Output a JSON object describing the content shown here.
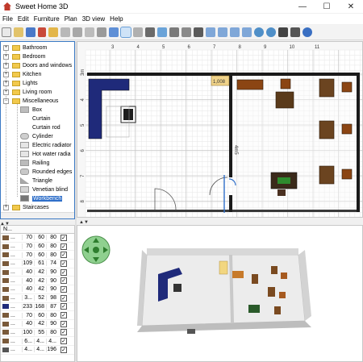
{
  "window": {
    "title": "Sweet Home 3D"
  },
  "menubar": {
    "items": [
      "File",
      "Edit",
      "Furniture",
      "Plan",
      "3D view",
      "Help"
    ]
  },
  "catalog": {
    "categories": [
      {
        "label": "Bathroom"
      },
      {
        "label": "Bedroom"
      },
      {
        "label": "Doors and windows"
      },
      {
        "label": "Kitchen"
      },
      {
        "label": "Lights"
      },
      {
        "label": "Living room"
      },
      {
        "label": "Miscellaneous"
      }
    ],
    "misc_items": [
      {
        "label": "Box"
      },
      {
        "label": "Curtain"
      },
      {
        "label": "Curtain rod"
      },
      {
        "label": "Cylinder"
      },
      {
        "label": "Electric radiator"
      },
      {
        "label": "Hot water radia"
      },
      {
        "label": "Railing"
      },
      {
        "label": "Rounded edges"
      },
      {
        "label": "Triangle"
      },
      {
        "label": "Venetian blind"
      },
      {
        "label": "Workbench"
      }
    ],
    "last_category": "Staircases",
    "selected": "Workbench"
  },
  "furniture_table": {
    "header": "N...",
    "rows": [
      {
        "name": "...",
        "w": "70",
        "d": "60",
        "h": "80",
        "visible": true
      },
      {
        "name": "...",
        "w": "70",
        "d": "60",
        "h": "80",
        "visible": true
      },
      {
        "name": "...",
        "w": "70",
        "d": "60",
        "h": "80",
        "visible": true
      },
      {
        "name": "...",
        "w": "109",
        "d": "61",
        "h": "74",
        "visible": true
      },
      {
        "name": "...",
        "w": "40",
        "d": "42",
        "h": "90",
        "visible": true
      },
      {
        "name": "...",
        "w": "40",
        "d": "42",
        "h": "90",
        "visible": true
      },
      {
        "name": "...",
        "w": "40",
        "d": "42",
        "h": "90",
        "visible": true
      },
      {
        "name": "...",
        "w": "3...",
        "d": "52",
        "h": "98",
        "visible": true
      },
      {
        "name": "...",
        "w": "233",
        "d": "168",
        "h": "87",
        "visible": true
      },
      {
        "name": "...",
        "w": "70",
        "d": "60",
        "h": "80",
        "visible": true
      },
      {
        "name": "...",
        "w": "40",
        "d": "42",
        "h": "90",
        "visible": true
      },
      {
        "name": "...",
        "w": "100",
        "d": "55",
        "h": "80",
        "visible": true
      },
      {
        "name": "...",
        "w": "6...",
        "d": "4...",
        "h": "4...",
        "visible": true
      },
      {
        "name": "...",
        "w": "4...",
        "d": "4...",
        "h": "196",
        "visible": true
      }
    ]
  },
  "plan": {
    "ruler_labels_top": [
      "3",
      "4",
      "5",
      "6",
      "7",
      "8",
      "9",
      "10",
      "11"
    ],
    "ruler_labels_left": [
      "3m",
      "4",
      "5",
      "6",
      "7",
      "8"
    ],
    "room_label": "1,008",
    "dimension_label": "4m5"
  },
  "colors": {
    "accent": "#2f6fc9",
    "sofa": "#1f2a7a",
    "wood": "#8b4513",
    "wall": "#1a1a1a"
  }
}
